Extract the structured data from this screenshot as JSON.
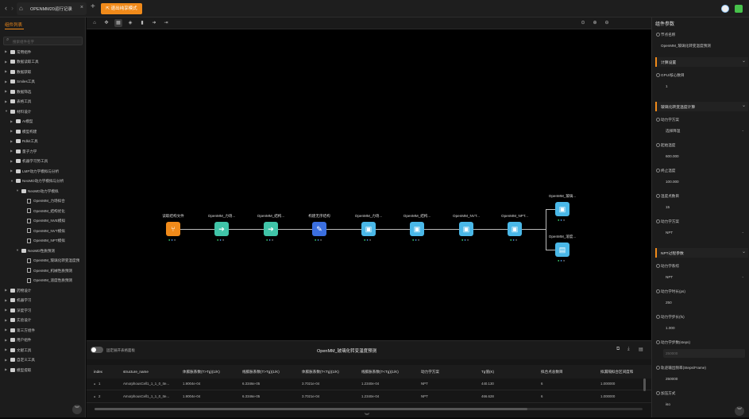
{
  "titlebar": {
    "tab_name": "OPENMM20运行记录",
    "exit_button": "退出纯享模式",
    "back_icon": "‹",
    "forward_icon": "›",
    "plus_label": "+",
    "close_label": "×"
  },
  "left_panel": {
    "title": "组件列表",
    "search_placeholder": "搜索组件名字",
    "items": [
      {
        "label": "常用组件",
        "level": 0,
        "type": "folder",
        "expanded": false
      },
      {
        "label": "数据读取工具",
        "level": 0,
        "type": "folder",
        "expanded": false
      },
      {
        "label": "数据获取",
        "level": 0,
        "type": "folder",
        "expanded": false
      },
      {
        "label": "Smiles工具",
        "level": 0,
        "type": "folder",
        "expanded": false
      },
      {
        "label": "数据筛选",
        "level": 0,
        "type": "folder",
        "expanded": false
      },
      {
        "label": "表格工具",
        "level": 0,
        "type": "folder",
        "expanded": false
      },
      {
        "label": "材料设计",
        "level": 0,
        "type": "folder",
        "expanded": true
      },
      {
        "label": "AI模型",
        "level": 1,
        "type": "folder",
        "expanded": false
      },
      {
        "label": "模型构建",
        "level": 1,
        "type": "folder",
        "expanded": false
      },
      {
        "label": "Rdkit工具",
        "level": 1,
        "type": "folder",
        "expanded": false
      },
      {
        "label": "量子力学",
        "level": 1,
        "type": "folder",
        "expanded": false
      },
      {
        "label": "机器学习势工具",
        "level": 1,
        "type": "folder",
        "expanded": false
      },
      {
        "label": "LMP动力学模拟与分析",
        "level": 1,
        "type": "folder",
        "expanded": false
      },
      {
        "label": "NeoMD动力学模拟与分析",
        "level": 1,
        "type": "folder",
        "expanded": true
      },
      {
        "label": "NeoMD动力学模拟",
        "level": 2,
        "type": "folder",
        "expanded": true
      },
      {
        "label": "OpenMM_力场拟合",
        "level": 3,
        "type": "doc"
      },
      {
        "label": "OpenMM_结构优化",
        "level": 3,
        "type": "doc"
      },
      {
        "label": "OpenMM_NVE模拟",
        "level": 3,
        "type": "doc"
      },
      {
        "label": "OpenMM_NVT模拟",
        "level": 3,
        "type": "doc"
      },
      {
        "label": "OpenMM_NPT模拟",
        "level": 3,
        "type": "doc"
      },
      {
        "label": "NeoMD性质预测",
        "level": 2,
        "type": "folder",
        "expanded": true
      },
      {
        "label": "OpenMM_玻璃化转变温度预",
        "level": 3,
        "type": "doc"
      },
      {
        "label": "OpenMM_机械性质预测",
        "level": 3,
        "type": "doc"
      },
      {
        "label": "OpenMM_溶度性质预测",
        "level": 3,
        "type": "doc"
      },
      {
        "label": "药物设计",
        "level": 0,
        "type": "folder",
        "expanded": false
      },
      {
        "label": "机器学习",
        "level": 0,
        "type": "folder",
        "expanded": false
      },
      {
        "label": "深度学习",
        "level": 0,
        "type": "folder",
        "expanded": false
      },
      {
        "label": "实验设计",
        "level": 0,
        "type": "folder",
        "expanded": false
      },
      {
        "label": "第三方组件",
        "level": 0,
        "type": "folder",
        "expanded": false
      },
      {
        "label": "用户组件",
        "level": 0,
        "type": "folder",
        "expanded": false
      },
      {
        "label": "文献工具",
        "level": 0,
        "type": "folder",
        "expanded": false
      },
      {
        "label": "自定义工具",
        "level": 0,
        "type": "folder",
        "expanded": false
      },
      {
        "label": "模型提取",
        "level": 0,
        "type": "folder",
        "expanded": false
      }
    ]
  },
  "toolbar": {
    "tools": [
      {
        "name": "home-tool",
        "icon": "⌂"
      },
      {
        "name": "select-tool",
        "icon": "✥"
      },
      {
        "name": "grid-tool",
        "icon": "▦"
      },
      {
        "name": "tag-tool",
        "icon": "◈"
      },
      {
        "name": "delete-tool",
        "icon": "▮"
      },
      {
        "name": "arrow-tool",
        "icon": "➜"
      },
      {
        "name": "export-tool",
        "icon": "⇥"
      }
    ],
    "right_icons": [
      {
        "name": "fit-icon",
        "icon": "⊙"
      },
      {
        "name": "zoom-in-icon",
        "icon": "⊕"
      },
      {
        "name": "zoom-out-icon",
        "icon": "⊖"
      }
    ],
    "zoom": "120%",
    "zoom_caret": "▾",
    "zoom_plus": "+"
  },
  "canvas": {
    "nodes": [
      {
        "label": "读取结构文件",
        "color": "#f08a1a",
        "glyph": "⑂"
      },
      {
        "label": "OpenMM_力场...",
        "color": "#40c4a8",
        "glyph": "➔"
      },
      {
        "label": "OpenMM_结构...",
        "color": "#40c4a8",
        "glyph": "➔"
      },
      {
        "label": "构建无序结构",
        "color": "#3b6fe0",
        "glyph": "✎"
      },
      {
        "label": "OpenMM_力场...",
        "color": "#4ab8e8",
        "glyph": "▣"
      },
      {
        "label": "OpenMM_结构...",
        "color": "#4ab8e8",
        "glyph": "▣"
      },
      {
        "label": "OpenMM_NVT...",
        "color": "#4ab8e8",
        "glyph": "▣"
      },
      {
        "label": "OpenMM_NPT...",
        "color": "#4ab8e8",
        "glyph": "▣"
      },
      {
        "label": "OpenMM_玻璃...",
        "color": "#4ab8e8",
        "glyph": "▣"
      },
      {
        "label": "OpenMM_溶度...",
        "color": "#4ab8e8",
        "glyph": "▤"
      }
    ]
  },
  "bottom_panel": {
    "toggle_label": "固定展开表格面板",
    "title": "OpenMM_玻璃化转变温度预测",
    "columns": [
      "index",
      "structure_name",
      "体膨胀系数(T>Tg)(1/K)",
      "线膨胀系数(T>Tg)(1/K)",
      "体膨胀系数(T<Tg)(1/K)",
      "线膨胀系数(T<Tg)(1/K)",
      "动力学方案",
      "Tg值(K)",
      "拟合点总数目",
      "拟漏隔拟合区间度和"
    ],
    "rows": [
      {
        "index": "1",
        "structure_name": "AmorphousCell1_1_1_0_Ite...",
        "c1": "1.9004e-04",
        "c2": "6.3346e-05",
        "c3": "3.7021e-04",
        "c4": "1.2340e-04",
        "c5": "NPT",
        "c6": "440.130",
        "c7": "6",
        "c8": "1.000000"
      },
      {
        "index": "2",
        "structure_name": "AmorphousCell1_1_1_0_Ite...",
        "c1": "1.9004e-04",
        "c2": "6.3346e-05",
        "c3": "3.7021e-04",
        "c4": "1.2340e-04",
        "c5": "NPT",
        "c6": "466.628",
        "c7": "6",
        "c8": "1.000000"
      }
    ],
    "row_marker": "●",
    "icons": [
      {
        "name": "expand-icon",
        "icon": "⧉"
      },
      {
        "name": "download-icon",
        "icon": "⤓"
      },
      {
        "name": "file-icon",
        "icon": "▤"
      }
    ],
    "collapse_chevron": "︾"
  },
  "right_panel": {
    "title": "组件参数",
    "node_name_label": "节点名称",
    "node_name_value": "OpenMM_玻璃化转变温度预测",
    "sections": [
      {
        "title": "计算设置",
        "fields": [
          {
            "label": "GPU/核心数目",
            "value": "1",
            "placeholder": false,
            "select": false
          }
        ]
      },
      {
        "title": "玻璃化转变温度计算",
        "fields": [
          {
            "label": "动力学方案",
            "value": "选择降温",
            "placeholder": false,
            "select": true
          },
          {
            "label": "起始温度",
            "value": "600.000",
            "placeholder": false,
            "select": false
          },
          {
            "label": "终止温度",
            "value": "100.000",
            "placeholder": false,
            "select": false
          },
          {
            "label": "温度点数目",
            "value": "15",
            "placeholder": false,
            "select": false
          },
          {
            "label": "动力学方案",
            "value": "NPT",
            "placeholder": false,
            "select": true
          }
        ]
      },
      {
        "title": "NPT过程参数",
        "fields": [
          {
            "label": "动力学系综",
            "value": "NPT",
            "placeholder": false,
            "select": true
          },
          {
            "label": "动力学时长(ps)",
            "value": "250",
            "placeholder": false,
            "select": false
          },
          {
            "label": "动力学步长(fs)",
            "value": "1.000",
            "placeholder": false,
            "select": false
          },
          {
            "label": "动力学步数(steps)",
            "value": "250000",
            "placeholder": true,
            "select": false
          },
          {
            "label": "轨迹输出频率(Steps/Frame)",
            "value": "250000",
            "placeholder": false,
            "select": false
          },
          {
            "label": "加压方式",
            "value": "iso",
            "placeholder": false,
            "select": false
          }
        ]
      }
    ],
    "section_chevron": "⌄",
    "select_caret": "⌄"
  },
  "colors": {
    "accent": "#f08a1a",
    "edge": "#bbbbbb",
    "status_green": "#3bd16f",
    "status_blue": "#4a8fe0"
  },
  "left_collapse_icon": "︾",
  "right_collapse_icon": "︾",
  "node_status": {
    "done": "●",
    "queued": "●",
    "idle": "●"
  }
}
